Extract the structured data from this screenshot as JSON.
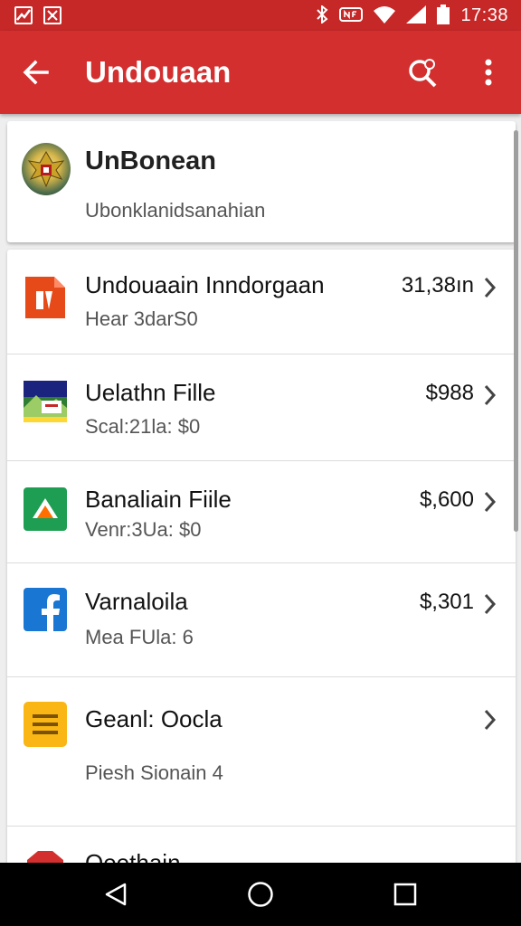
{
  "status_bar": {
    "time": "17:38",
    "icons": [
      "trend-icon",
      "calendar-icon",
      "bluetooth-icon",
      "nfc-icon",
      "wifi-icon",
      "signal-icon",
      "battery-icon"
    ]
  },
  "app_bar": {
    "title": "Undouaan",
    "icons": [
      "back-arrow-icon",
      "search-icon",
      "more-vert-icon"
    ],
    "color": "#d32f2f"
  },
  "header": {
    "title": "UnBonean",
    "subtitle": "Ubonklanidsanahian"
  },
  "items": [
    {
      "title": "Undouaain Inndorgaan",
      "subtitle": "Hear 3darS0",
      "amount": "31,38ın",
      "icon": "document-icon"
    },
    {
      "title": "Uelathn Fille",
      "subtitle": "Scal:21la: $0",
      "amount": "$988",
      "icon": "landscape-thumbnail-icon"
    },
    {
      "title": "Banaliain Fiile",
      "subtitle": "Venr:3Ua: $0",
      "amount": "$,600",
      "icon": "google-drive-icon"
    },
    {
      "title": "Varnaloila",
      "subtitle": "Mea FUla: 6",
      "amount": "$,301",
      "icon": "facebook-icon"
    },
    {
      "title": "Geanl: Oocla",
      "subtitle": "Piesh Sionain 4",
      "amount": "",
      "icon": "folder-list-icon"
    },
    {
      "title": "Oeethain",
      "subtitle": "",
      "amount": "",
      "icon": "red-shape-icon"
    }
  ],
  "navigation": {
    "icons": [
      "back-triangle-icon",
      "home-circle-icon",
      "recents-square-icon"
    ]
  }
}
